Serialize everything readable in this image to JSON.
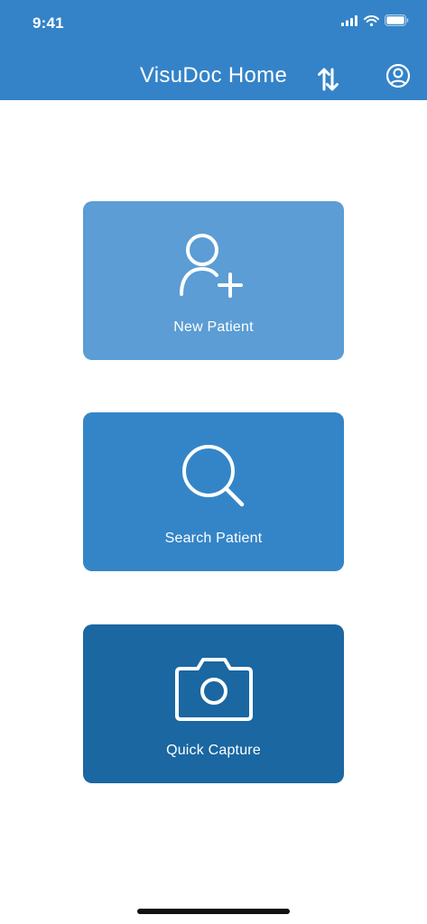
{
  "status_bar": {
    "time": "9:41",
    "icons": [
      "cellular-signal-icon",
      "wifi-icon",
      "battery-icon"
    ]
  },
  "header": {
    "title": "VisuDoc Home",
    "actions": [
      "sort-arrows-icon",
      "profile-icon"
    ]
  },
  "cards": [
    {
      "label": "New Patient",
      "icon": "add-user-icon",
      "color": "#5b9dd4"
    },
    {
      "label": "Search Patient",
      "icon": "search-icon",
      "color": "#3485c8"
    },
    {
      "label": "Quick Capture",
      "icon": "camera-icon",
      "color": "#1a67a2"
    }
  ],
  "colors": {
    "header": "#3483c8",
    "background": "#ffffff",
    "text_on_color": "#ffffff"
  }
}
